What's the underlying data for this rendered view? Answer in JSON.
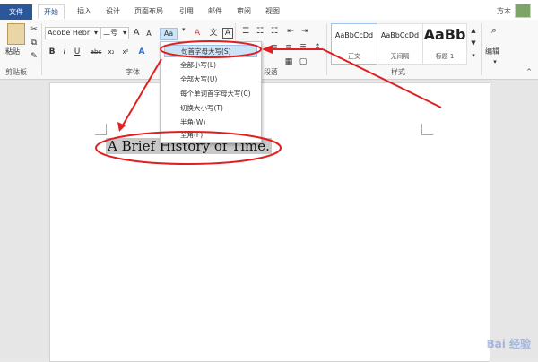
{
  "tabs": [
    {
      "label": "文件"
    },
    {
      "label": "开始"
    },
    {
      "label": "插入"
    },
    {
      "label": "设计"
    },
    {
      "label": "页面布局"
    },
    {
      "label": "引用"
    },
    {
      "label": "邮件"
    },
    {
      "label": "审阅"
    },
    {
      "label": "视图"
    }
  ],
  "user": {
    "name": "方木"
  },
  "clipboard": {
    "paste_label": "粘贴",
    "group_label": "剪贴板"
  },
  "font": {
    "name": "Adobe Hebr",
    "size": "二号",
    "group_label": "字体",
    "grow": "A",
    "shrink": "A",
    "case": "Aa",
    "bold": "B",
    "italic": "I",
    "underline": "U",
    "strike": "abc",
    "text_effects": "A"
  },
  "paragraph": {
    "group_label": "段落"
  },
  "styles": {
    "group_label": "样式",
    "items": [
      {
        "sample": "AaBbCcDd",
        "name": "正文"
      },
      {
        "sample": "AaBbCcDd",
        "name": "无间隔"
      },
      {
        "sample": "AaBb",
        "name": "标题 1"
      }
    ]
  },
  "editing": {
    "label": "编辑"
  },
  "change_case_menu": {
    "items": [
      {
        "label": "句首字母大写(S)"
      },
      {
        "label": "全部小写(L)"
      },
      {
        "label": "全部大写(U)"
      },
      {
        "label": "每个单词首字母大写(C)"
      },
      {
        "label": "切换大小写(T)"
      },
      {
        "label": "半角(W)"
      },
      {
        "label": "全角(F)"
      }
    ]
  },
  "document": {
    "title": "A Brief History of Time."
  },
  "watermark": {
    "text": "Bai 经验"
  },
  "colors": {
    "file_tab": "#2b579a",
    "annotation": "#e02020",
    "highlight": "#cde3f7"
  }
}
